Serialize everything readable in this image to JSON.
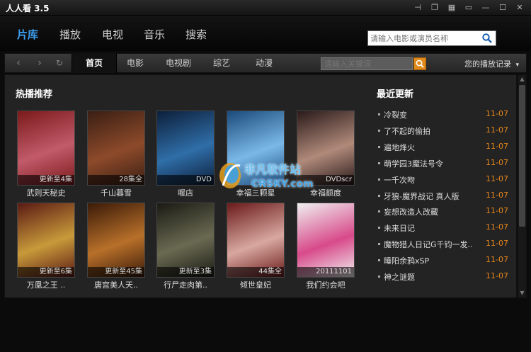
{
  "app": {
    "title": "人人看 3.5"
  },
  "window_controls": [
    "pin-icon",
    "restore-icon",
    "skin-icon",
    "mini-mode-icon",
    "minimize-icon",
    "maximize-icon",
    "close-icon"
  ],
  "main_nav": {
    "tabs": [
      {
        "label": "片库",
        "active": true
      },
      {
        "label": "播放",
        "active": false
      },
      {
        "label": "电视",
        "active": false
      },
      {
        "label": "音乐",
        "active": false
      },
      {
        "label": "搜索",
        "active": false
      }
    ],
    "search_placeholder": "请输入电影或演员名称"
  },
  "sub_nav": {
    "tabs": [
      {
        "label": "首页",
        "active": true
      },
      {
        "label": "电影",
        "active": false
      },
      {
        "label": "电视剧",
        "active": false
      },
      {
        "label": "综艺",
        "active": false
      },
      {
        "label": "动漫",
        "active": false
      }
    ],
    "keyword_placeholder": "请输入关键词",
    "history_label": "您的播放记录"
  },
  "hot": {
    "title": "热播推荐",
    "items": [
      {
        "title": "武则天秘史",
        "status": "更新至4集",
        "colors": [
          "#7a1a1a",
          "#c25a6a"
        ]
      },
      {
        "title": "千山暮雪",
        "status": "28集全",
        "colors": [
          "#3a1f14",
          "#8d4a2a"
        ]
      },
      {
        "title": "喔店",
        "status": "DVD",
        "colors": [
          "#0d1f3a",
          "#2f6ea8"
        ]
      },
      {
        "title": "幸福三颗星",
        "status": "",
        "colors": [
          "#1a4a7a",
          "#7ab8e8"
        ]
      },
      {
        "title": "幸福额度",
        "status": "DVDscr",
        "colors": [
          "#2a1a1a",
          "#b08a7a"
        ]
      },
      {
        "title": "万凰之王 ..",
        "status": "更新至6集",
        "colors": [
          "#5a1a14",
          "#c89a3a"
        ]
      },
      {
        "title": "唐宫美人天..",
        "status": "更新至45集",
        "colors": [
          "#3a1a08",
          "#b8702a"
        ]
      },
      {
        "title": "行尸走肉第..",
        "status": "更新至3集",
        "colors": [
          "#1a1a14",
          "#6a6a52"
        ]
      },
      {
        "title": "倾世皇妃",
        "status": "44集全",
        "colors": [
          "#6a1a1a",
          "#d8a8a0"
        ]
      },
      {
        "title": "我们约会吧",
        "status": "20111101",
        "colors": [
          "#f0f0f0",
          "#d84a8a"
        ]
      }
    ]
  },
  "latest": {
    "title": "最近更新",
    "items": [
      {
        "name": "冷裂变",
        "date": "11-07"
      },
      {
        "name": "了不起的偷拍",
        "date": "11-07"
      },
      {
        "name": "遍地烽火",
        "date": "11-07"
      },
      {
        "name": "萌学园3魔法号令",
        "date": "11-07"
      },
      {
        "name": "一千次吻",
        "date": "11-07"
      },
      {
        "name": "牙狼-魔界战记 真人版",
        "date": "11-07"
      },
      {
        "name": "妄想改造人改藏",
        "date": "11-07"
      },
      {
        "name": "未来日记",
        "date": "11-07"
      },
      {
        "name": "魔物猎人日记G千钧一发..",
        "date": "11-07"
      },
      {
        "name": "睡阳余鸦xSP",
        "date": "11-07"
      },
      {
        "name": "神之谜题",
        "date": "11-07"
      }
    ]
  },
  "watermark": {
    "title": "非凡软件站",
    "sub": "CRSKY.com"
  },
  "colors": {
    "accent": "#3da0f2",
    "date": "#e8861c",
    "search_go": "#e08a1c"
  }
}
